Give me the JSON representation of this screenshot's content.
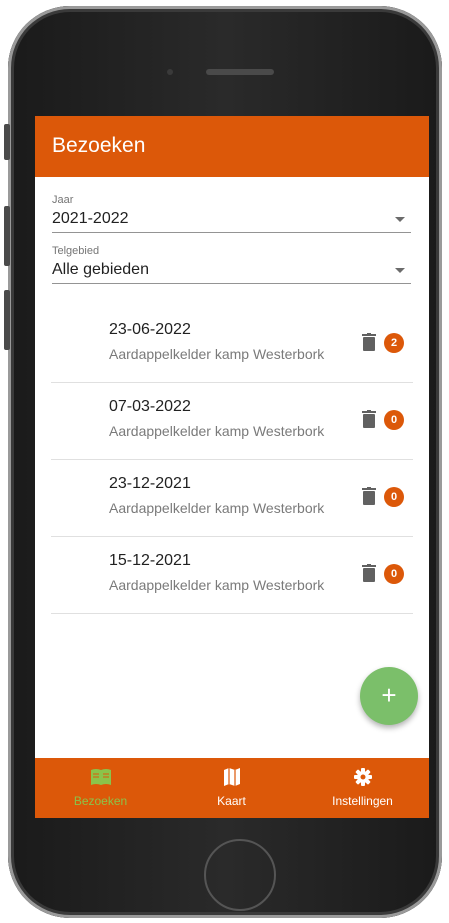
{
  "app": {
    "title": "Bezoeken"
  },
  "filters": {
    "year": {
      "label": "Jaar",
      "value": "2021-2022"
    },
    "area": {
      "label": "Telgebied",
      "value": "Alle gebieden"
    }
  },
  "visits": [
    {
      "date": "23-06-2022",
      "location": "Aardappelkelder kamp Westerbork",
      "count": "2"
    },
    {
      "date": "07-03-2022",
      "location": "Aardappelkelder kamp Westerbork",
      "count": "0"
    },
    {
      "date": "23-12-2021",
      "location": "Aardappelkelder kamp Westerbork",
      "count": "0"
    },
    {
      "date": "15-12-2021",
      "location": "Aardappelkelder kamp Westerbork",
      "count": "0"
    }
  ],
  "fab": {
    "label": "+"
  },
  "nav": [
    {
      "label": "Bezoeken",
      "icon": "book-icon",
      "active": true
    },
    {
      "label": "Kaart",
      "icon": "map-icon",
      "active": false
    },
    {
      "label": "Instellingen",
      "icon": "gear-icon",
      "active": false
    }
  ],
  "colors": {
    "primary": "#dc5809",
    "accent": "#7bbf6a",
    "active_nav": "#8bc34a"
  }
}
